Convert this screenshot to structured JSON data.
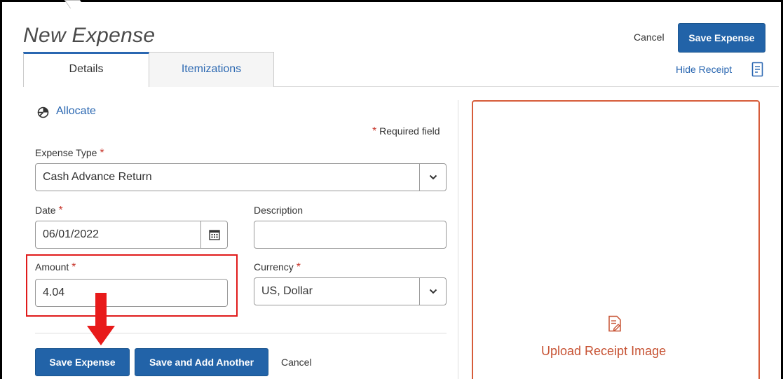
{
  "header": {
    "title": "New Expense",
    "cancel_label": "Cancel",
    "save_label": "Save Expense"
  },
  "tabs": [
    {
      "label": "Details",
      "active": true
    },
    {
      "label": "Itemizations",
      "active": false
    }
  ],
  "receipt_toggle": {
    "label": "Hide Receipt",
    "icon": "receipt-icon"
  },
  "allocate": {
    "label": "Allocate",
    "icon": "pie-chart-icon"
  },
  "required_note": {
    "star": "*",
    "label": "Required field"
  },
  "form": {
    "expense_type": {
      "label": "Expense Type",
      "star": "*",
      "value": "Cash Advance Return"
    },
    "date": {
      "label": "Date",
      "star": "*",
      "value": "06/01/2022"
    },
    "description": {
      "label": "Description",
      "value": ""
    },
    "amount": {
      "label": "Amount",
      "star": "*",
      "value": "4.04"
    },
    "currency": {
      "label": "Currency",
      "star": "*",
      "value": "US, Dollar"
    }
  },
  "footer": {
    "save_label": "Save Expense",
    "save_add_label": "Save and Add Another",
    "cancel_label": "Cancel"
  },
  "receipt_panel": {
    "upload_label": "Upload Receipt Image",
    "icon": "upload-receipt-icon"
  },
  "colors": {
    "primary_button": "#2263a8",
    "link": "#2a67b1",
    "required_star": "#c8372d",
    "highlight": "#e01b1b",
    "receipt_border": "#d65c3a"
  }
}
